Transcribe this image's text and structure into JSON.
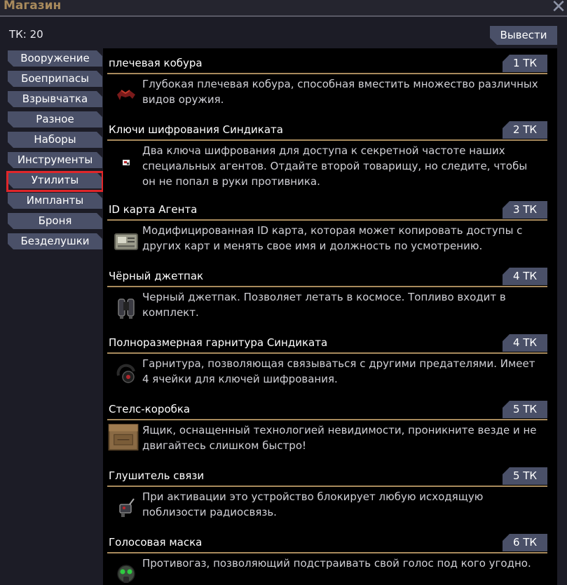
{
  "window": {
    "title": "Магазин",
    "close_icon": "close-icon"
  },
  "balance": {
    "text": "ТК: 20"
  },
  "withdraw_label": "Вывести",
  "categories": [
    {
      "label": "Вооружение"
    },
    {
      "label": "Боеприпасы"
    },
    {
      "label": "Взрывчатка"
    },
    {
      "label": "Разное"
    },
    {
      "label": "Наборы"
    },
    {
      "label": "Инструменты"
    },
    {
      "label": "Утилиты",
      "selected": true
    },
    {
      "label": "Импланты"
    },
    {
      "label": "Броня"
    },
    {
      "label": "Безделушки"
    }
  ],
  "items": [
    {
      "name": "плечевая кобура",
      "price": "1 ТК",
      "icon": "holster-icon",
      "description": "Глубокая плечевая кобура, способная вместить множество различных видов оружия."
    },
    {
      "name": "Ключи шифрования Синдиката",
      "price": "2 ТК",
      "icon": "encryption-key-icon",
      "description": "Два ключа шифрования для доступа к секретной частоте наших специальных агентов. Отдайте второй товарищу, но следите, чтобы он не попал в руки противника."
    },
    {
      "name": "ID карта Агента",
      "price": "3 ТК",
      "icon": "id-card-icon",
      "description": "Модифицированная ID карта, которая может копировать доступы с других карт и менять свое имя и должность по усмотрению."
    },
    {
      "name": "Чёрный джетпак",
      "price": "4 ТК",
      "icon": "jetpack-icon",
      "description": "Черный джетпак. Позволяет летать в космосе. Топливо входит в комплект."
    },
    {
      "name": "Полноразмерная гарнитура Синдиката",
      "price": "4 ТК",
      "icon": "headset-icon",
      "description": "Гарнитура, позволяющая связываться с другими предателями. Имеет 4 ячейки для ключей шифрования."
    },
    {
      "name": "Стелс-коробка",
      "price": "5 ТК",
      "icon": "cardboard-box-icon",
      "description": "Ящик, оснащенный технологией невидимости, проникните везде и не двигайтесь слишком быстро!"
    },
    {
      "name": "Глушитель связи",
      "price": "5 ТК",
      "icon": "radio-jammer-icon",
      "description": "При активации это устройство блокирует любую исходящую поблизости радиосвязь."
    },
    {
      "name": "Голосовая маска",
      "price": "6 ТК",
      "icon": "gas-mask-icon",
      "description": "Противогаз, позволяющий подстраивать свой голос под кого угодно."
    }
  ]
}
